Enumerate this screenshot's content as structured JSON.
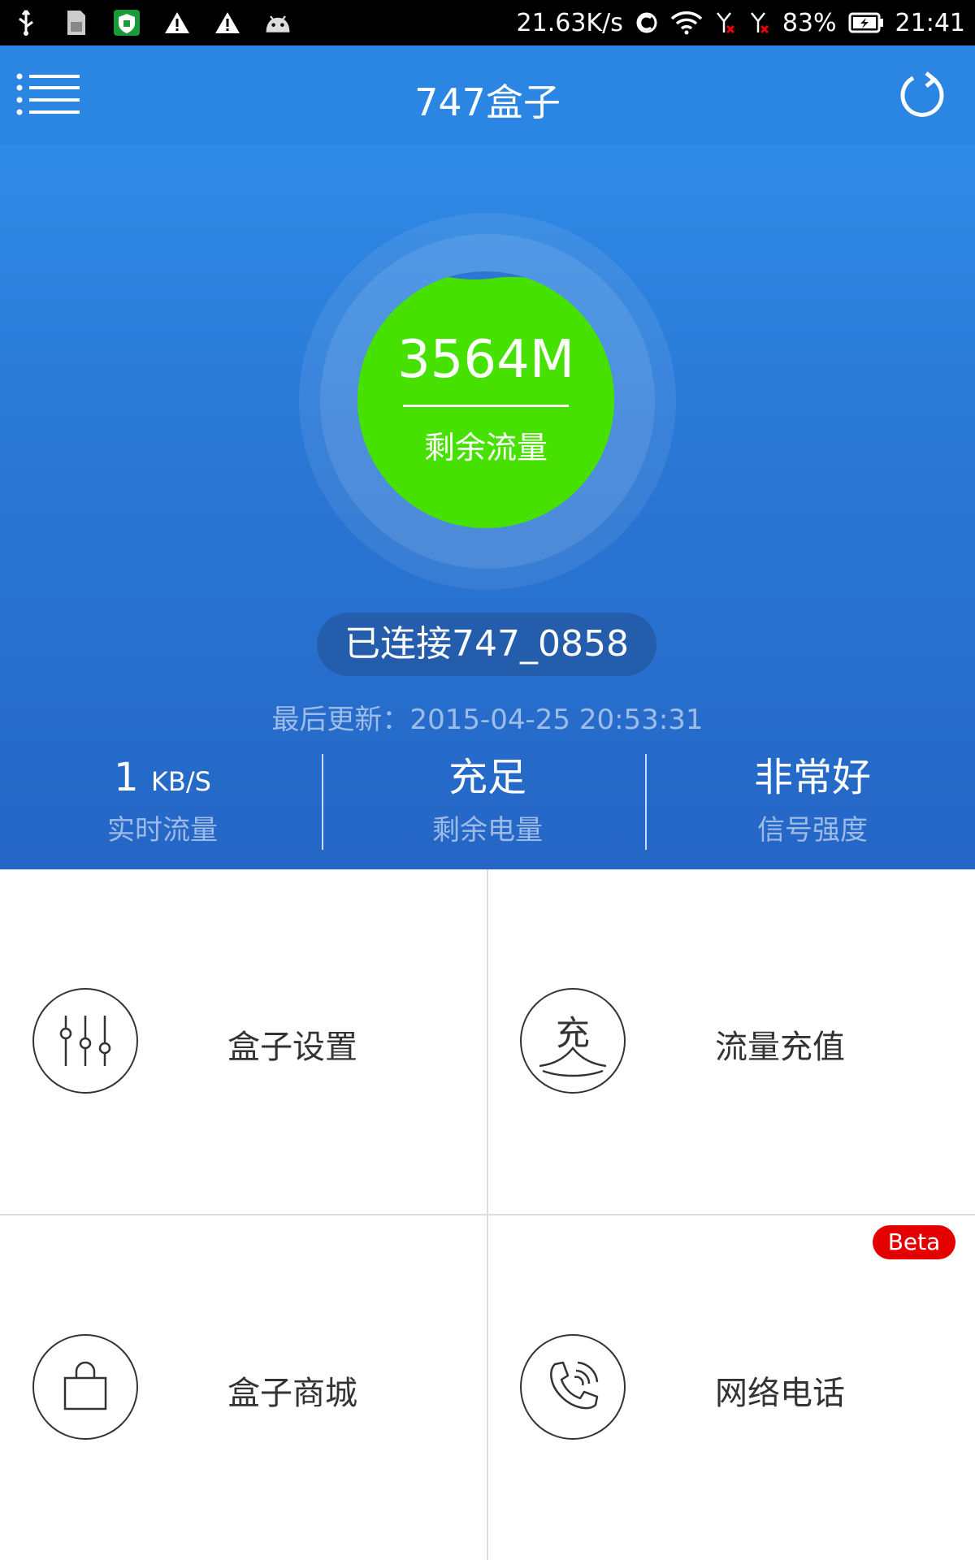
{
  "status_bar": {
    "net_speed": "21.63K/s",
    "battery": "83%",
    "time": "21:41"
  },
  "app_bar": {
    "title": "747盒子"
  },
  "hero": {
    "remaining_amount": "3564M",
    "remaining_label": "剩余流量",
    "connection": "已连接747_0858",
    "last_update": "最后更新：2015-04-25 20:53:31",
    "stats": [
      {
        "value": "1",
        "unit": "KB/S",
        "label": "实时流量"
      },
      {
        "value": "充足",
        "label": "剩余电量"
      },
      {
        "value": "非常好",
        "label": "信号强度"
      }
    ]
  },
  "grid": {
    "items": [
      {
        "label": "盒子设置",
        "icon": "sliders-icon"
      },
      {
        "label": "流量充值",
        "icon": "recharge-icon",
        "icon_text": "充"
      },
      {
        "label": "盒子商城",
        "icon": "shopping-bag-icon"
      },
      {
        "label": "网络电话",
        "icon": "phone-call-icon",
        "badge": "Beta"
      }
    ]
  },
  "colors": {
    "app_bar": "#2b86e3",
    "green": "#47e100",
    "badge": "#e40000"
  }
}
